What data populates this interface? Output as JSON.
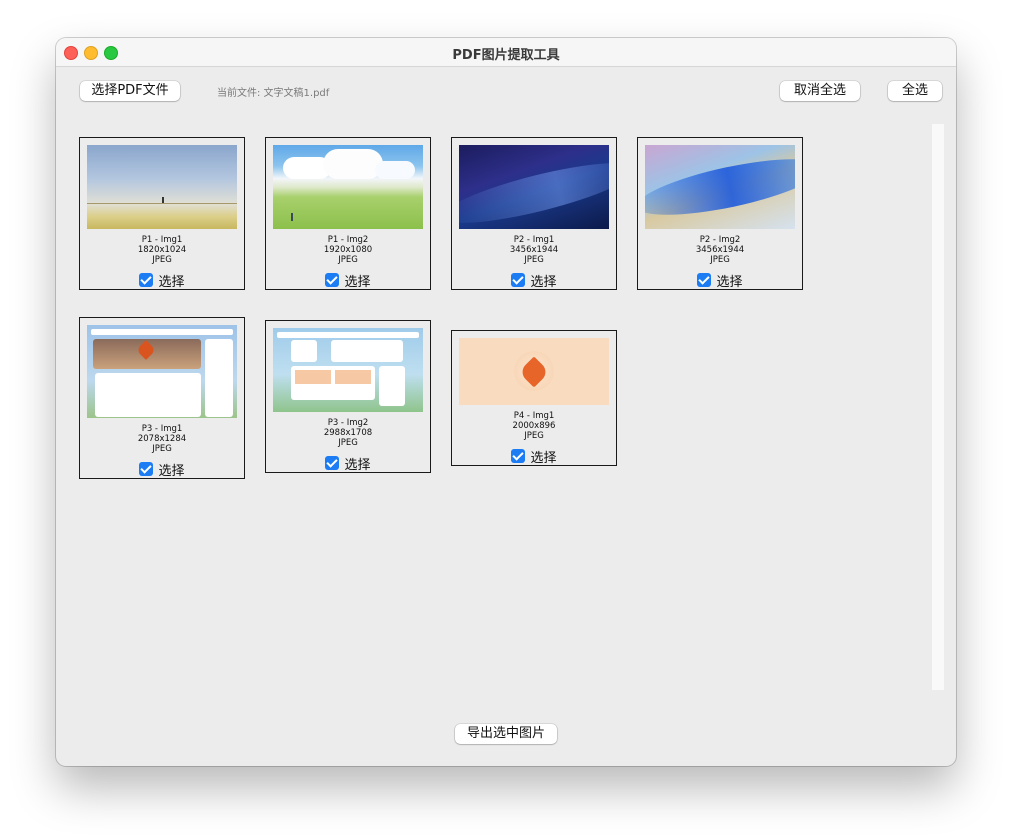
{
  "window": {
    "title": "PDF图片提取工具"
  },
  "toolbar": {
    "select_pdf": "选择PDF文件",
    "current_file": "当前文件: 文字文稿1.pdf",
    "deselect_all": "取消全选",
    "select_all": "全选"
  },
  "images": [
    {
      "label": "P1 - Img1",
      "size": "1820x1024",
      "format": "JPEG",
      "checked": true,
      "select_label": "选择"
    },
    {
      "label": "P1 - Img2",
      "size": "1920x1080",
      "format": "JPEG",
      "checked": true,
      "select_label": "选择"
    },
    {
      "label": "P2 - Img1",
      "size": "3456x1944",
      "format": "JPEG",
      "checked": true,
      "select_label": "选择"
    },
    {
      "label": "P2 - Img2",
      "size": "3456x1944",
      "format": "JPEG",
      "checked": true,
      "select_label": "选择"
    },
    {
      "label": "P3 - Img1",
      "size": "2078x1284",
      "format": "JPEG",
      "checked": true,
      "select_label": "选择"
    },
    {
      "label": "P3 - Img2",
      "size": "2988x1708",
      "format": "JPEG",
      "checked": true,
      "select_label": "选择"
    },
    {
      "label": "P4 - Img1",
      "size": "2000x896",
      "format": "JPEG",
      "checked": true,
      "select_label": "选择"
    }
  ],
  "footer": {
    "export": "导出选中图片"
  },
  "colors": {
    "checkbox": "#1b7cf4",
    "window_bg": "#ececec"
  }
}
